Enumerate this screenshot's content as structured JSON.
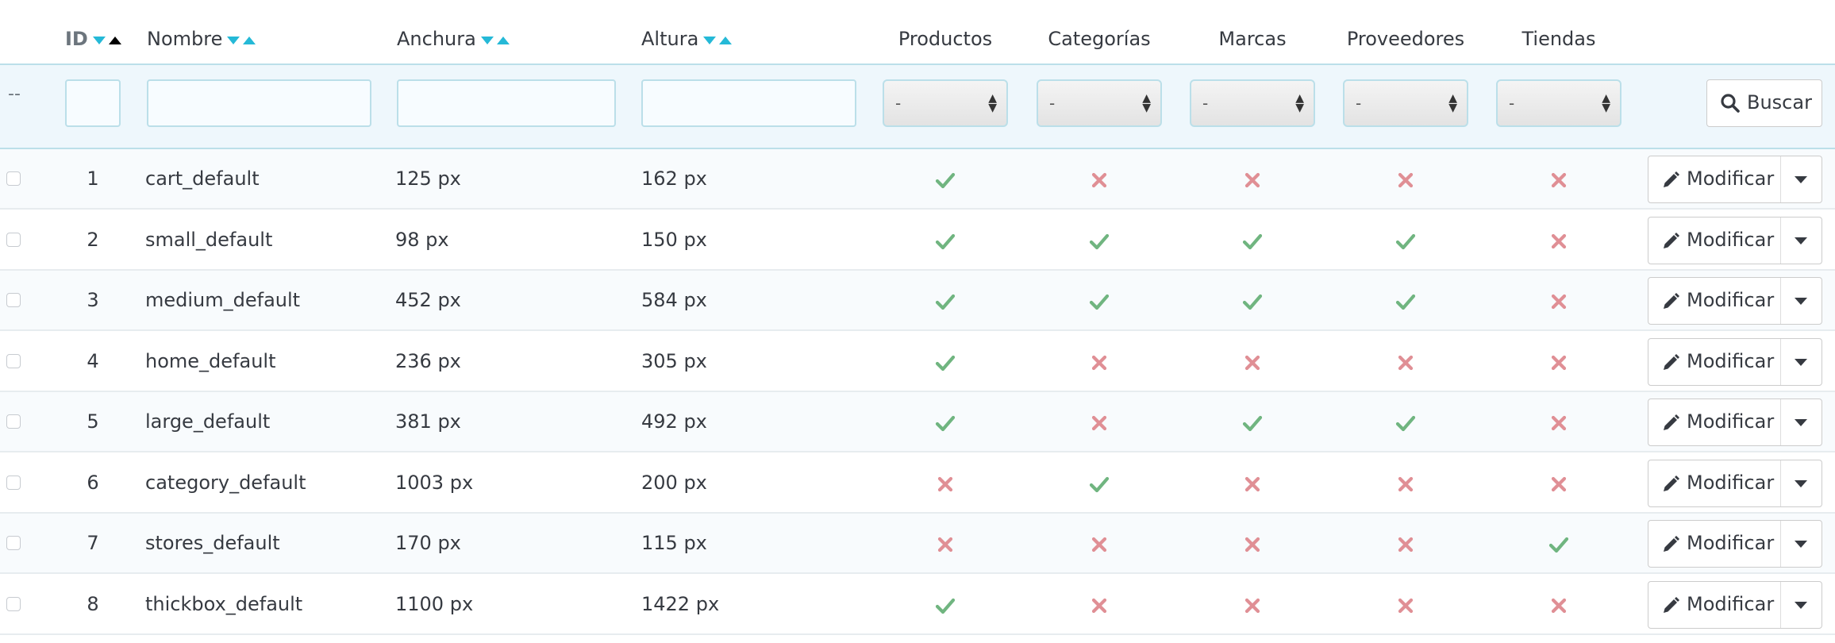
{
  "columns": {
    "id": "ID",
    "name": "Nombre",
    "width": "Anchura",
    "height": "Altura",
    "products": "Productos",
    "categories": "Categorías",
    "brands": "Marcas",
    "suppliers": "Proveedores",
    "stores": "Tiendas"
  },
  "filters": {
    "bulk_placeholder": "--",
    "select_value": "-",
    "search_label": "Buscar"
  },
  "row_action": "Modificar",
  "colors": {
    "accent": "#25b9d7",
    "check": "#70b580",
    "cross": "#e08f95",
    "header_border": "#bbdfe9"
  },
  "rows": [
    {
      "id": "1",
      "name": "cart_default",
      "width": "125 px",
      "height": "162 px",
      "products": true,
      "categories": false,
      "brands": false,
      "suppliers": false,
      "stores": false
    },
    {
      "id": "2",
      "name": "small_default",
      "width": "98 px",
      "height": "150 px",
      "products": true,
      "categories": true,
      "brands": true,
      "suppliers": true,
      "stores": false
    },
    {
      "id": "3",
      "name": "medium_default",
      "width": "452 px",
      "height": "584 px",
      "products": true,
      "categories": true,
      "brands": true,
      "suppliers": true,
      "stores": false
    },
    {
      "id": "4",
      "name": "home_default",
      "width": "236 px",
      "height": "305 px",
      "products": true,
      "categories": false,
      "brands": false,
      "suppliers": false,
      "stores": false
    },
    {
      "id": "5",
      "name": "large_default",
      "width": "381 px",
      "height": "492 px",
      "products": true,
      "categories": false,
      "brands": true,
      "suppliers": true,
      "stores": false
    },
    {
      "id": "6",
      "name": "category_default",
      "width": "1003 px",
      "height": "200 px",
      "products": false,
      "categories": true,
      "brands": false,
      "suppliers": false,
      "stores": false
    },
    {
      "id": "7",
      "name": "stores_default",
      "width": "170 px",
      "height": "115 px",
      "products": false,
      "categories": false,
      "brands": false,
      "suppliers": false,
      "stores": true
    },
    {
      "id": "8",
      "name": "thickbox_default",
      "width": "1100 px",
      "height": "1422 px",
      "products": true,
      "categories": false,
      "brands": false,
      "suppliers": false,
      "stores": false
    }
  ]
}
